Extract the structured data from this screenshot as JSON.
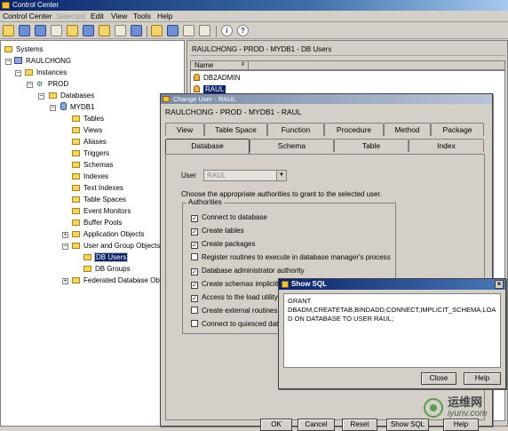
{
  "window": {
    "title": "Control Center"
  },
  "menu": [
    "Control Center",
    "Selected",
    "Edit",
    "View",
    "Tools",
    "Help"
  ],
  "tree": {
    "items": [
      {
        "label": "Systems"
      },
      {
        "label": "RAULCHONG"
      },
      {
        "label": "Instances"
      },
      {
        "label": "PROD"
      },
      {
        "label": "Databases"
      },
      {
        "label": "MYDB1"
      },
      {
        "label": "Tables"
      },
      {
        "label": "Views"
      },
      {
        "label": "Aliases"
      },
      {
        "label": "Triggers"
      },
      {
        "label": "Schemas"
      },
      {
        "label": "Indexes"
      },
      {
        "label": "Text Indexes"
      },
      {
        "label": "Table Spaces"
      },
      {
        "label": "Event Monitors"
      },
      {
        "label": "Buffer Pools"
      },
      {
        "label": "Application Objects"
      },
      {
        "label": "User and Group Objects"
      },
      {
        "label": "DB Users"
      },
      {
        "label": "DB Groups"
      },
      {
        "label": "Federated Database Ob"
      }
    ]
  },
  "contents": {
    "header": "RAULCHONG - PROD - MYDB1 - DB Users",
    "column": "Name",
    "rows": [
      "DB2ADMIN",
      "RAUL"
    ]
  },
  "dialog": {
    "title": "Change User - RAUL",
    "subtitle": "RAULCHONG - PROD - MYDB1 - RAUL",
    "tabs_back": [
      "View",
      "Table Space",
      "Function",
      "Procedure",
      "Method",
      "Package"
    ],
    "tabs_front": [
      "Database",
      "Schema",
      "Table",
      "Index"
    ],
    "user_label": "User",
    "user_value": "RAUL",
    "instruction": "Choose the appropriate authorities to grant to the selected user.",
    "authorities_title": "Authorities",
    "authorities": [
      {
        "label": "Connect to database",
        "checked": true
      },
      {
        "label": "Create tables",
        "checked": true
      },
      {
        "label": "Create packages",
        "checked": true
      },
      {
        "label": "Register routines to execute in database manager's process",
        "checked": false
      },
      {
        "label": "Database administrator authority",
        "checked": true
      },
      {
        "label": "Create schemas implicitly",
        "checked": true
      },
      {
        "label": "Access to the load utility",
        "checked": true
      },
      {
        "label": "Create external routines",
        "checked": false
      },
      {
        "label": "Connect to quiesced datal",
        "checked": false
      }
    ],
    "buttons": [
      "OK",
      "Cancel",
      "Reset",
      "Show SQL",
      "Help"
    ]
  },
  "show_sql": {
    "title": "Show SQL",
    "lines": [
      "GRANT",
      "DBADM,CREATETAB,BINDADD,CONNECT,IMPLICIT_SCHEMA,LOA",
      "D ON DATABASE  TO USER RAUL;"
    ],
    "close": "Close",
    "help": "Help"
  },
  "watermark": {
    "text1": "运维网",
    "text2": "iyunv.com"
  }
}
